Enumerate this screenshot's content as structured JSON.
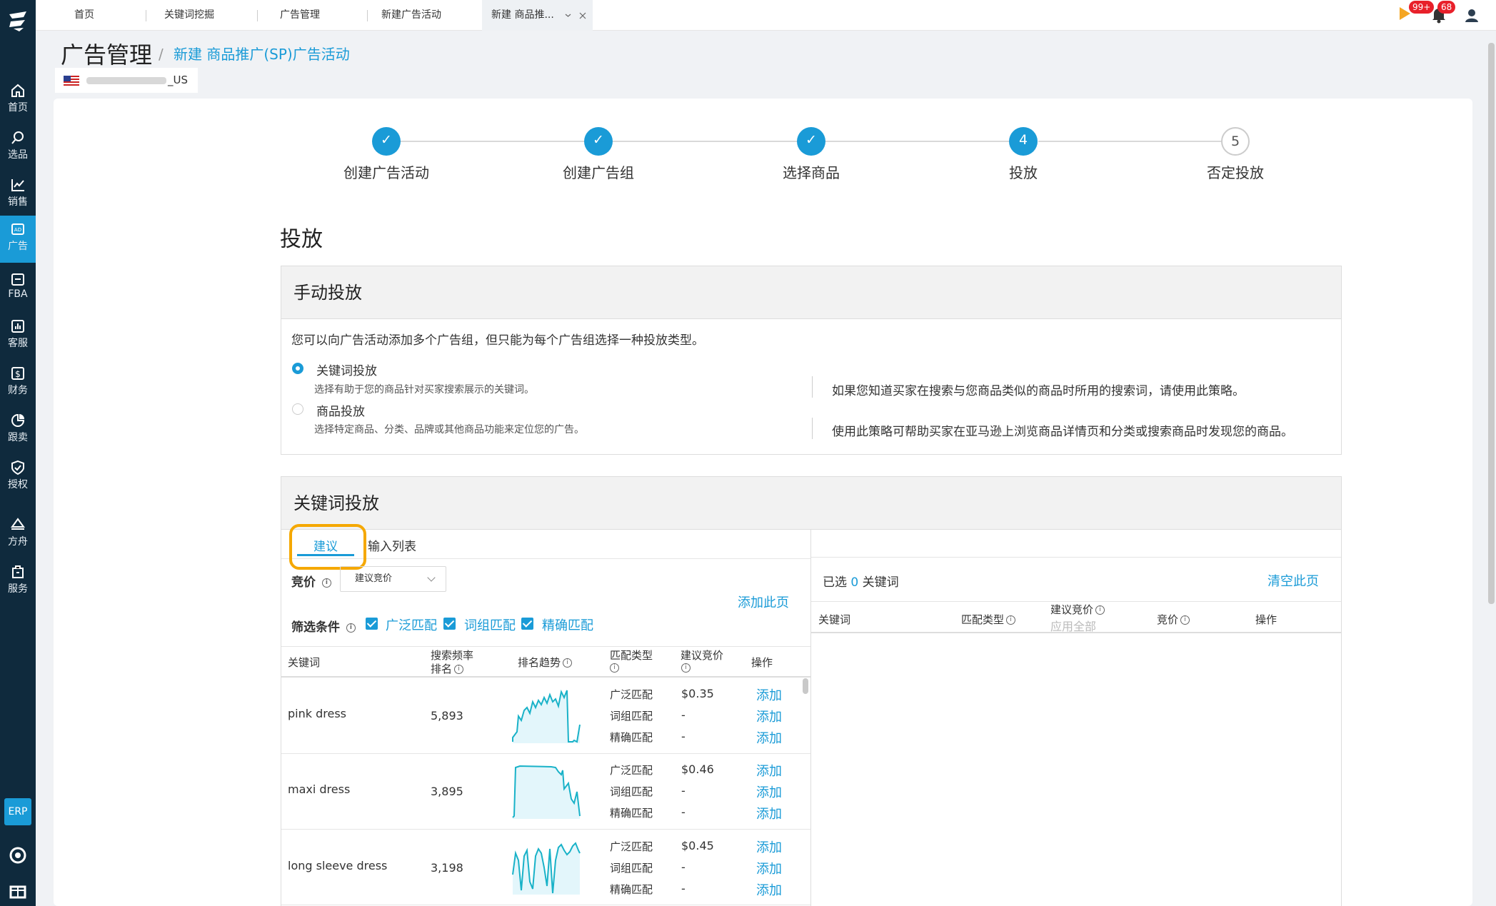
{
  "nav": {
    "items": [
      {
        "label": "首页",
        "icon": "home-icon"
      },
      {
        "label": "选品",
        "icon": "search-icon"
      },
      {
        "label": "销售",
        "icon": "chart-icon"
      },
      {
        "label": "广告",
        "icon": "ad-icon"
      },
      {
        "label": "FBA",
        "icon": "box-icon"
      },
      {
        "label": "客服",
        "icon": "bar-chart-icon"
      },
      {
        "label": "财务",
        "icon": "dollar-icon"
      },
      {
        "label": "跟卖",
        "icon": "pie-icon"
      },
      {
        "label": "授权",
        "icon": "shield-icon"
      },
      {
        "label": "方舟",
        "icon": "ark-icon"
      },
      {
        "label": "服务",
        "icon": "building-icon"
      }
    ],
    "erp": "ERP"
  },
  "tabs": [
    "首页",
    "关键词挖掘",
    "广告管理",
    "新建广告活动",
    "新建 商品推..."
  ],
  "badges": {
    "flag": "99+",
    "bell": "68"
  },
  "page": {
    "title": "广告管理",
    "crumb_sep": "/",
    "breadcrumb": "新建 商品推广(SP)广告活动",
    "store_suffix": "_US"
  },
  "steps": [
    {
      "label": "创建广告活动",
      "state": "done",
      "num": "✓"
    },
    {
      "label": "创建广告组",
      "state": "done",
      "num": "✓"
    },
    {
      "label": "选择商品",
      "state": "done",
      "num": "✓"
    },
    {
      "label": "投放",
      "state": "cur",
      "num": "4"
    },
    {
      "label": "否定投放",
      "state": "todo",
      "num": "5"
    }
  ],
  "section_title": "投放",
  "manual": {
    "title": "手动投放",
    "desc": "您可以向广告活动添加多个广告组，但只能为每个广告组选择一种投放类型。",
    "kw_label": "关键词投放",
    "kw_sub": "选择有助于您的商品针对买家搜索展示的关键词。",
    "kw_tip": "如果您知道买家在搜索与您商品类似的商品时所用的搜索词，请使用此策略。",
    "prod_label": "商品投放",
    "prod_sub": "选择特定商品、分类、品牌或其他商品功能来定位您的广告。",
    "prod_tip": "使用此策略可帮助买家在亚马逊上浏览商品详情页和分类或搜索商品时发现您的商品。"
  },
  "kw": {
    "title": "关键词投放",
    "tab_suggest": "建议",
    "tab_input": "输入列表",
    "bid_label": "竞价",
    "bid_select": "建议竞价",
    "add_page": "添加此页",
    "filter_label": "筛选条件",
    "filters": [
      "广泛匹配",
      "词组匹配",
      "精确匹配"
    ],
    "cols": {
      "keyword": "关键词",
      "rank1": "搜索频率",
      "rank2": "排名",
      "trend": "排名趋势",
      "match": "匹配类型",
      "bid": "建议竞价",
      "op": "操作"
    },
    "rows": [
      {
        "keyword": "pink dress",
        "rank": "5,893",
        "matches": [
          "广泛匹配",
          "词组匹配",
          "精确匹配"
        ],
        "bids": [
          "$0.35",
          "-",
          "-"
        ],
        "action": "添加"
      },
      {
        "keyword": "maxi dress",
        "rank": "3,895",
        "matches": [
          "广泛匹配",
          "词组匹配",
          "精确匹配"
        ],
        "bids": [
          "$0.46",
          "-",
          "-"
        ],
        "action": "添加"
      },
      {
        "keyword": "long sleeve dress",
        "rank": "3,198",
        "matches": [
          "广泛匹配",
          "词组匹配",
          "精确匹配"
        ],
        "bids": [
          "$0.45",
          "-",
          "-"
        ],
        "action": "添加"
      }
    ]
  },
  "selected": {
    "prefix": "已选",
    "count": "0",
    "suffix": "关键词",
    "clear": "清空此页",
    "cols": {
      "keyword": "关键词",
      "match": "匹配类型",
      "sbid": "建议竞价",
      "apply_all": "应用全部",
      "bid": "竞价",
      "op": "操作"
    }
  },
  "colors": {
    "accent": "#1a9bd7",
    "sidebar": "#0f2a3d",
    "highlight": "#f5a800"
  }
}
